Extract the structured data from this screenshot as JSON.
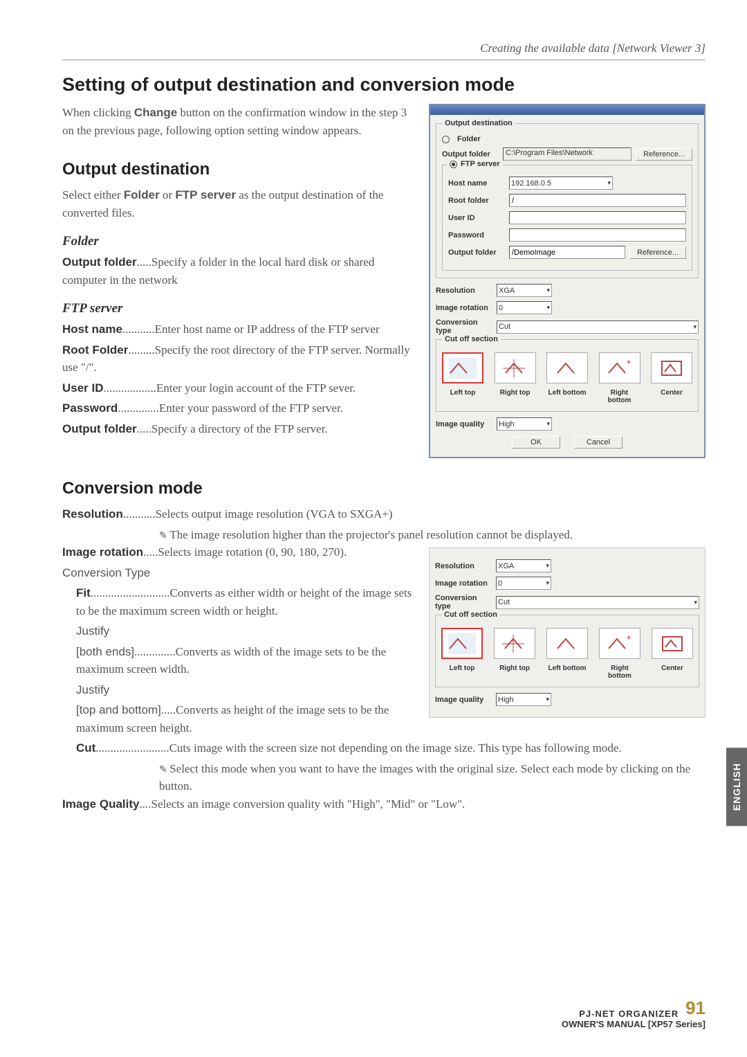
{
  "hdr": "Creating the available data [Network Viewer 3]",
  "h1": "Setting of output destination and conversion mode",
  "p1a": "When clicking ",
  "p1b": "Change",
  "p1c": " button on the confirmation window in the step 3 on the previous page, following option setting window appears.",
  "h2a": "Output destination",
  "p2a": "Select either ",
  "p2b": "Folder",
  "p2c": " or ",
  "p2d": "FTP server",
  "p2e": " as the output destination of the converted files.",
  "h3a": "Folder",
  "defs": {
    "of": "Output folder",
    "ofd": ".....Specify a folder in the local hard disk or shared computer in the network"
  },
  "h3b": "FTP server",
  "ftp": {
    "hn": "Host name",
    "hnd": "...........Enter host name or IP address of the FTP server",
    "rf": "Root Folder",
    "rfd": ".........Specify the root directory of the FTP server. Normally use \"/\".",
    "ui": "User ID",
    "uid": "..................Enter your login account of the FTP sever.",
    "pw": "Password",
    "pwd": "..............Enter your password of the FTP server.",
    "of": "Output folder",
    "ofd": ".....Specify a directory of the FTP server."
  },
  "h2b": "Conversion mode",
  "cm": {
    "res": "Resolution",
    "resd": "...........Selects output image resolution (VGA to SXGA+)",
    "resn": "The image resolution higher than the projector's panel resolution cannot be displayed.",
    "ir": "Image rotation",
    "ird": ".....Selects image rotation (0, 90, 180, 270).",
    "ct": "Conversion Type",
    "fit": "Fit",
    "fitd": "...........................Converts as either width or height of the image sets to be the maximum screen width or height.",
    "j1": "Justify",
    "be": "[both ends]",
    "bed": "..............Converts as width of the image sets to be the maximum screen width.",
    "j2": "Justify",
    "tb": "[top and bottom]",
    "tbd": ".....Converts as height of the image sets to be the maximum screen height.",
    "cut": "Cut",
    "cutd": ".........................Cuts image with the screen size not depending on the image size. This type has following mode.",
    "cutn": "Select this mode when you want to have the images with the original size. Select each mode by clicking on the button.",
    "iq": "Image Quality",
    "iqd": "....Selects an image conversion quality with \"High\", \"Mid\" or \"Low\"."
  },
  "dlg": {
    "od": "Output destination",
    "folder": "Folder",
    "ofl": "Output folder",
    "ofv": "C:\\Program Files\\Network",
    "ref": "Reference...",
    "ftp": "FTP server",
    "hn": "Host name",
    "hnv": "192.168.0.5",
    "rf": "Root folder",
    "rfv": "/",
    "ui": "User ID",
    "uiv": "",
    "pw": "Password",
    "pwv": "",
    "of2": "Output folder",
    "of2v": "/DemoImage",
    "ref2": "Reference...",
    "res": "Resolution",
    "resv": "XGA",
    "ir": "Image rotation",
    "irv": "0",
    "ct": "Conversion type",
    "ctv": "Cut",
    "cos": "Cut off section",
    "t1": "Left top",
    "t2": "Right top",
    "t3": "Left bottom",
    "t4": "Right bottom",
    "t5": "Center",
    "iq": "Image quality",
    "iqv": "High",
    "ok": "OK",
    "cancel": "Cancel"
  },
  "lang": "ENGLISH",
  "ft1": "PJ-NET ORGANIZER",
  "pg": "91",
  "ft2": "OWNER'S MANUAL [XP57 Series]"
}
